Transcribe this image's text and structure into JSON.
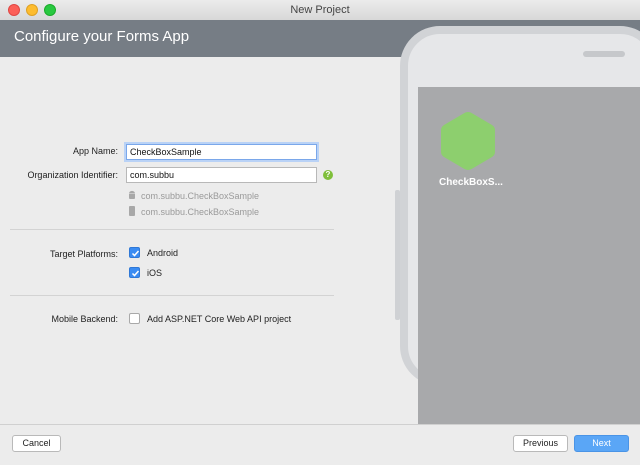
{
  "window": {
    "title": "New Project"
  },
  "header": {
    "title": "Configure your Forms App"
  },
  "form": {
    "app_name": {
      "label": "App Name:",
      "value": "CheckBoxSample"
    },
    "org_identifier": {
      "label": "Organization Identifier:",
      "value": "com.subbu"
    },
    "android_bundle": "com.subbu.CheckBoxSample",
    "ios_bundle": "com.subbu.CheckBoxSample",
    "target_platforms": {
      "label": "Target Platforms:",
      "options": [
        {
          "label": "Android",
          "checked": true
        },
        {
          "label": "iOS",
          "checked": true
        }
      ]
    },
    "mobile_backend": {
      "label": "Mobile Backend:",
      "option": {
        "label": "Add ASP.NET Core Web API project",
        "checked": false
      }
    }
  },
  "preview": {
    "app_label": "CheckBoxS...",
    "hex_color": "#8dcf6e",
    "screen_color": "#a8a9ab"
  },
  "footer": {
    "cancel_label": "Cancel",
    "previous_label": "Previous",
    "next_label": "Next"
  },
  "colors": {
    "header_bg": "#767d85",
    "accent": "#3b8cf2",
    "help": "#7fbf3a"
  }
}
